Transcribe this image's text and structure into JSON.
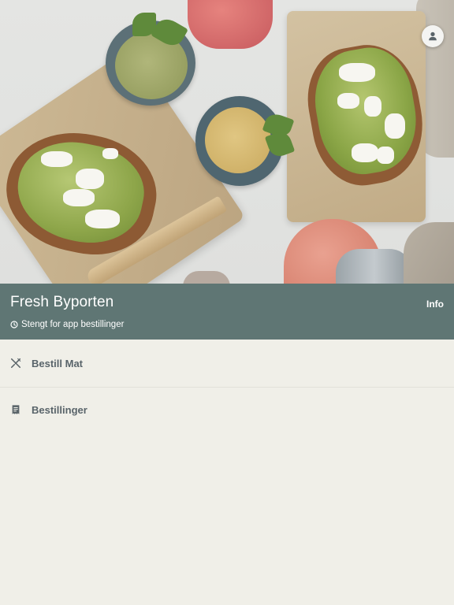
{
  "hero": {
    "profile_icon": "person-icon"
  },
  "header": {
    "store_name": "Fresh Byporten",
    "info_label": "Info",
    "status_icon": "clock-icon",
    "status_text": "Stengt for app bestillinger",
    "background_color": "#5f7674"
  },
  "menu": {
    "items": [
      {
        "icon": "utensils-icon",
        "label": "Bestill Mat"
      },
      {
        "icon": "receipt-icon",
        "label": "Bestillinger"
      }
    ]
  }
}
